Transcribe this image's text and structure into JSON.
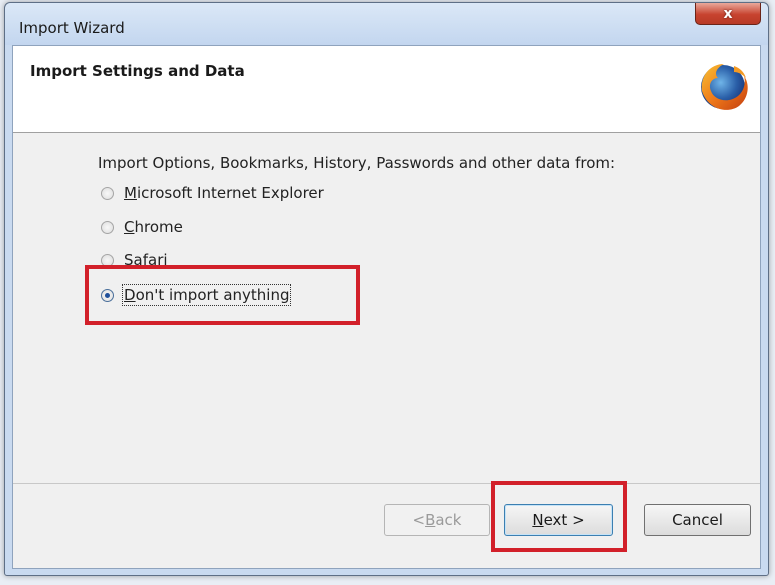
{
  "window": {
    "title": "Import Wizard",
    "close_symbol": "x"
  },
  "header": {
    "title": "Import Settings and Data",
    "logo_icon": "firefox-icon"
  },
  "prompt": "Import Options, Bookmarks, History, Passwords and other data from:",
  "options": [
    {
      "pre": "",
      "accel": "M",
      "post": "icrosoft Internet Explorer",
      "selected": false
    },
    {
      "pre": "",
      "accel": "C",
      "post": "hrome",
      "selected": false
    },
    {
      "pre": "",
      "accel": "S",
      "post": "afari",
      "selected": false
    },
    {
      "pre": "",
      "accel": "D",
      "post": "on't import anything",
      "selected": true
    }
  ],
  "buttons": {
    "back": {
      "pre": "< ",
      "accel": "B",
      "post": "ack",
      "enabled": false
    },
    "next": {
      "pre": "",
      "accel": "N",
      "post": "ext >",
      "enabled": true
    },
    "cancel": {
      "label": "Cancel"
    }
  },
  "annotation_color": "#d2202a"
}
